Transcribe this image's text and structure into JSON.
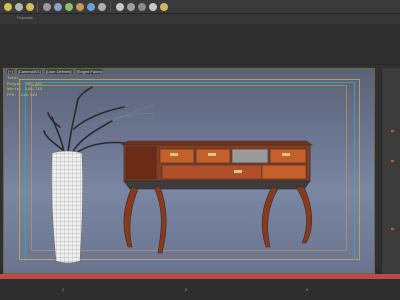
{
  "ribbon": {
    "label": "Populate"
  },
  "viewport": {
    "labels": [
      "[+]",
      "[Camera001]",
      "[User Defined]",
      "[Edged Faces]"
    ],
    "stats": [
      {
        "label": "Total",
        "value": ""
      },
      {
        "label": "Polys:",
        "value": "295,281"
      },
      {
        "label": "Verts:",
        "value": "148,713"
      },
      {
        "label": "",
        "value": ""
      },
      {
        "label": "FPS:",
        "value": "118.922"
      }
    ]
  },
  "trackbar": {
    "ticks": [
      "2",
      "5",
      "8"
    ]
  },
  "colors": {
    "accent": "#c24848",
    "safe_frame": "#c9a84a",
    "stats_text": "#e0d040"
  }
}
